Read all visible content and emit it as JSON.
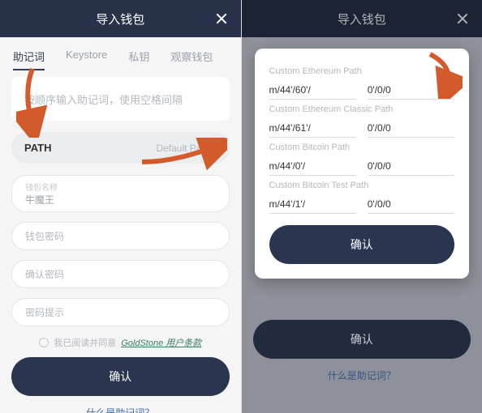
{
  "header": {
    "title": "导入钱包"
  },
  "tabs": [
    "助记词",
    "Keystore",
    "私钥",
    "观察钱包"
  ],
  "mnemonic_placeholder": "按顺序输入助记词，使用空格间隔",
  "path_row": {
    "label": "PATH",
    "value": "Default Path"
  },
  "fields": {
    "wallet_name_label": "钱包名称",
    "wallet_name_value": "牛魔王",
    "wallet_pwd": "钱包密码",
    "confirm_pwd": "确认密码",
    "pwd_hint": "密码提示"
  },
  "terms": {
    "prefix": "我已阅读并同意",
    "link": "GoldStone 用户条款"
  },
  "confirm_btn": "确认",
  "help_link": "什么是助记词？",
  "modal": {
    "sections": [
      {
        "label": "Custom Ethereum Path",
        "prefix": "m/44'/60'/",
        "suffix": "0'/0/0"
      },
      {
        "label": "Custom Ethereum Classic Path",
        "prefix": "m/44'/61'/",
        "suffix": "0'/0/0"
      },
      {
        "label": "Custom Bitcoin Path",
        "prefix": "m/44'/0'/",
        "suffix": "0'/0/0"
      },
      {
        "label": "Custom Bitcoin Test Path",
        "prefix": "m/44'/1'/",
        "suffix": "0'/0/0"
      }
    ],
    "confirm": "确认"
  }
}
